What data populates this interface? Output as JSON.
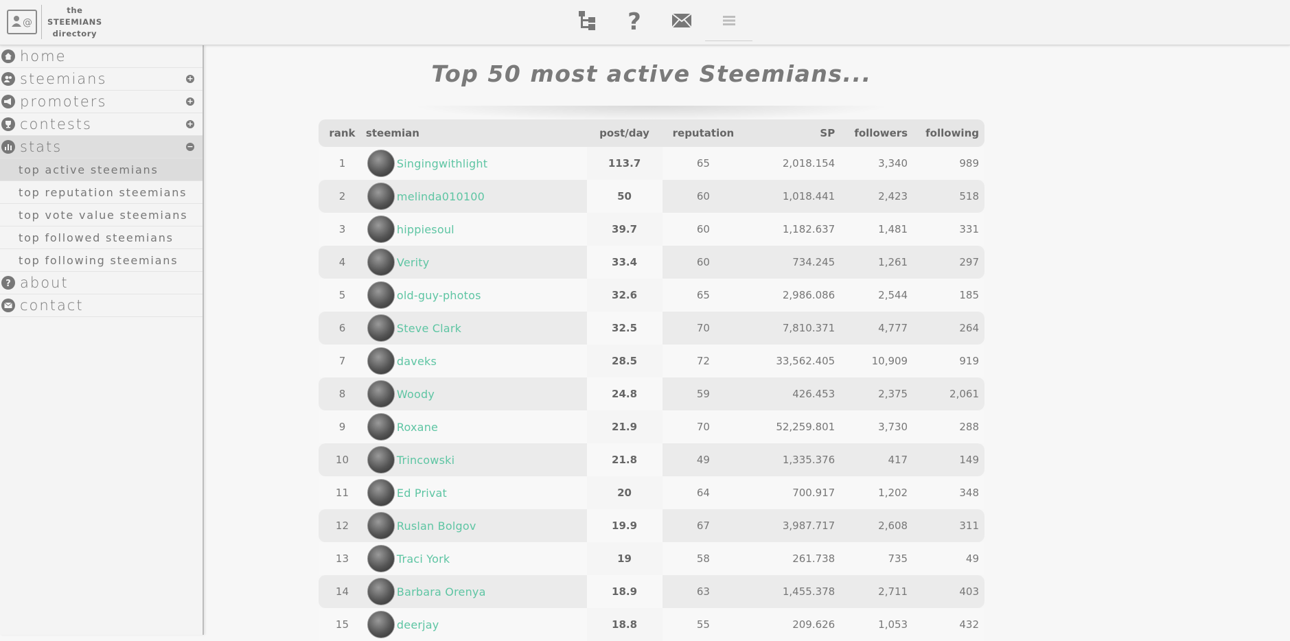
{
  "logo": {
    "line1": "the",
    "line2": "STEEMIANS",
    "line3": "directory"
  },
  "top_icons": [
    "sitemap-icon",
    "help-icon",
    "mail-icon",
    "menu-icon"
  ],
  "sidebar": {
    "items": [
      {
        "label": "home",
        "icon": "home-icon"
      },
      {
        "label": "steemians",
        "icon": "users-icon",
        "toggle": "+"
      },
      {
        "label": "promoters",
        "icon": "megaphone-icon",
        "toggle": "+"
      },
      {
        "label": "contests",
        "icon": "trophy-icon",
        "toggle": "+"
      },
      {
        "label": "stats",
        "icon": "bar-chart-icon",
        "toggle": "−"
      },
      {
        "label": "about",
        "icon": "help-icon"
      },
      {
        "label": "contact",
        "icon": "mail-icon"
      }
    ],
    "stats_sub": [
      "top active steemians",
      "top reputation steemians",
      "top vote value steemians",
      "top followed steemians",
      "top following steemians"
    ]
  },
  "page_title": "Top 50 most active Steemians...",
  "table": {
    "headers": {
      "rank": "rank",
      "steemian": "steemian",
      "post_day": "post/day",
      "reputation": "reputation",
      "sp": "SP",
      "followers": "followers",
      "following": "following"
    },
    "rows": [
      {
        "rank": "1",
        "name": "Singingwithlight",
        "post": "113.7",
        "rep": "65",
        "sp": "2,018.154",
        "followers": "3,340",
        "following": "989"
      },
      {
        "rank": "2",
        "name": "melinda010100",
        "post": "50",
        "rep": "60",
        "sp": "1,018.441",
        "followers": "2,423",
        "following": "518"
      },
      {
        "rank": "3",
        "name": "hippiesoul",
        "post": "39.7",
        "rep": "60",
        "sp": "1,182.637",
        "followers": "1,481",
        "following": "331"
      },
      {
        "rank": "4",
        "name": "Verity",
        "post": "33.4",
        "rep": "60",
        "sp": "734.245",
        "followers": "1,261",
        "following": "297"
      },
      {
        "rank": "5",
        "name": "old-guy-photos",
        "post": "32.6",
        "rep": "65",
        "sp": "2,986.086",
        "followers": "2,544",
        "following": "185"
      },
      {
        "rank": "6",
        "name": "Steve Clark",
        "post": "32.5",
        "rep": "70",
        "sp": "7,810.371",
        "followers": "4,777",
        "following": "264"
      },
      {
        "rank": "7",
        "name": "daveks",
        "post": "28.5",
        "rep": "72",
        "sp": "33,562.405",
        "followers": "10,909",
        "following": "919"
      },
      {
        "rank": "8",
        "name": "Woody",
        "post": "24.8",
        "rep": "59",
        "sp": "426.453",
        "followers": "2,375",
        "following": "2,061"
      },
      {
        "rank": "9",
        "name": "Roxane",
        "post": "21.9",
        "rep": "70",
        "sp": "52,259.801",
        "followers": "3,730",
        "following": "288"
      },
      {
        "rank": "10",
        "name": "Trincowski",
        "post": "21.8",
        "rep": "49",
        "sp": "1,335.376",
        "followers": "417",
        "following": "149"
      },
      {
        "rank": "11",
        "name": "Ed Privat",
        "post": "20",
        "rep": "64",
        "sp": "700.917",
        "followers": "1,202",
        "following": "348"
      },
      {
        "rank": "12",
        "name": "Ruslan Bolgov",
        "post": "19.9",
        "rep": "67",
        "sp": "3,987.717",
        "followers": "2,608",
        "following": "311"
      },
      {
        "rank": "13",
        "name": "Traci York",
        "post": "19",
        "rep": "58",
        "sp": "261.738",
        "followers": "735",
        "following": "49"
      },
      {
        "rank": "14",
        "name": "Barbara Orenya",
        "post": "18.9",
        "rep": "63",
        "sp": "1,455.378",
        "followers": "2,711",
        "following": "403"
      },
      {
        "rank": "15",
        "name": "deerjay",
        "post": "18.8",
        "rep": "55",
        "sp": "209.626",
        "followers": "1,053",
        "following": "432"
      }
    ]
  },
  "colors": {
    "link": "#5ec5a3",
    "text": "#777777",
    "accent_gray": "#7a7a7a"
  }
}
